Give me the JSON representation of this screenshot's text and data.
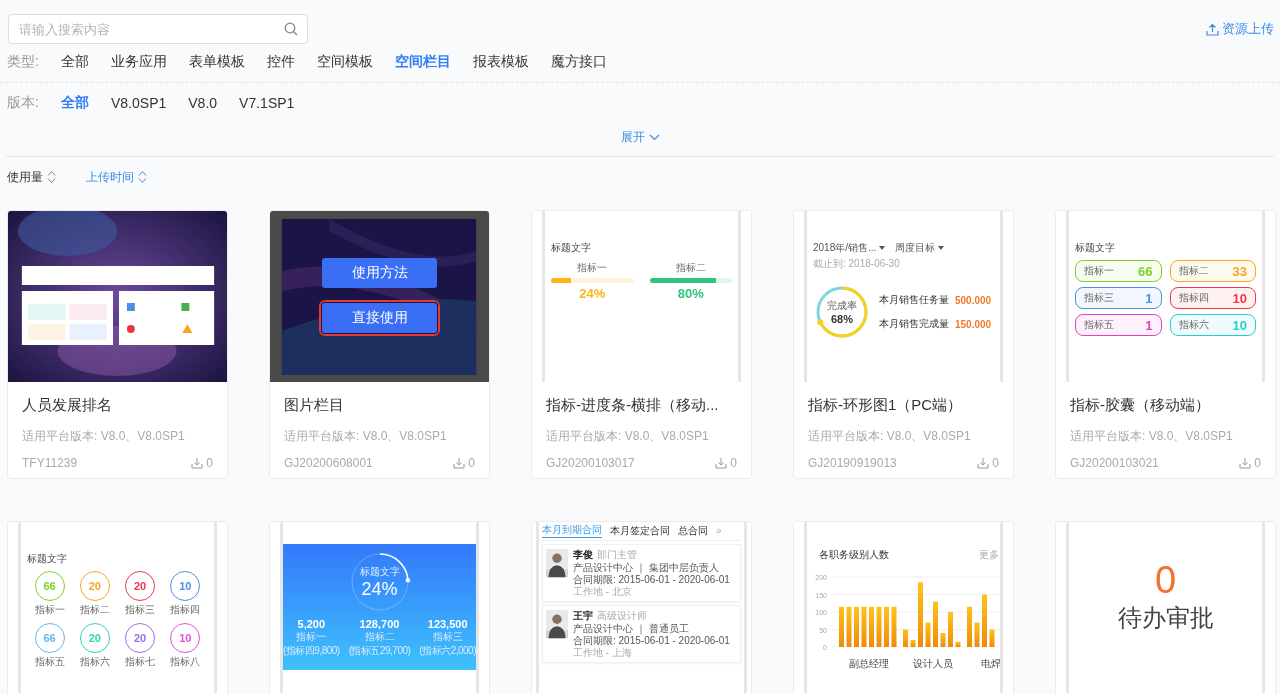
{
  "search": {
    "placeholder": "请输入搜索内容"
  },
  "upload_link": "资源上传",
  "filters": [
    {
      "label": "类型:",
      "options": [
        {
          "text": "全部",
          "selected": false
        },
        {
          "text": "业务应用",
          "selected": false
        },
        {
          "text": "表单模板",
          "selected": false
        },
        {
          "text": "控件",
          "selected": false
        },
        {
          "text": "空间模板",
          "selected": false
        },
        {
          "text": "空间栏目",
          "selected": true
        },
        {
          "text": "报表模板",
          "selected": false
        },
        {
          "text": "魔方接口",
          "selected": false
        }
      ]
    },
    {
      "label": "版本:",
      "options": [
        {
          "text": "全部",
          "selected": true
        },
        {
          "text": "V8.0SP1",
          "selected": false
        },
        {
          "text": "V8.0",
          "selected": false
        },
        {
          "text": "V7.1SP1",
          "selected": false
        }
      ]
    }
  ],
  "expand": {
    "label": "展开",
    "expanded": false
  },
  "sort": [
    {
      "label": "使用量",
      "selected": false
    },
    {
      "label": "上传时间",
      "selected": true
    }
  ],
  "cards": [
    {
      "title": "人员发展排名",
      "platform": "适用平台版本: V8.0、V8.0SP1",
      "code": "TFY11239",
      "downloads": "0"
    },
    {
      "title": "图片栏目",
      "platform": "适用平台版本: V8.0、V8.0SP1",
      "code": "GJ20200608001",
      "downloads": "0",
      "preview": {
        "kind": "buttons",
        "buttons": [
          {
            "text": "使用方法",
            "focused": false
          },
          {
            "text": "直接使用",
            "focused": true
          }
        ]
      }
    },
    {
      "title": "指标-进度条-横排（移动...",
      "platform": "适用平台版本: V8.0、V8.0SP1",
      "code": "GJ20200103017",
      "downloads": "0",
      "preview": {
        "kind": "progress",
        "heading": "标题文字",
        "items": [
          {
            "label": "指标一",
            "level": 0.24,
            "value": "24%",
            "color": "#fbb41a"
          },
          {
            "label": "指标二",
            "level": 0.8,
            "value": "80%",
            "color": "#2fc57c"
          }
        ]
      }
    },
    {
      "title": "指标-环形图1（PC端）",
      "platform": "适用平台版本: V8.0、V8.0SP1",
      "code": "GJ20190919013",
      "downloads": "0",
      "preview": {
        "kind": "ring",
        "selects": [
          "2018年/销售...",
          "周度目标"
        ],
        "date": "截止到: 2018-06-30",
        "ring_label": "完成率",
        "ring_value": "68%",
        "rows": [
          {
            "label": "本月销售任务量",
            "value": "500.000"
          },
          {
            "label": "本月销售完成量",
            "value": "150.000"
          }
        ]
      }
    },
    {
      "title": "指标-胶囊（移动端）",
      "platform": "适用平台版本: V8.0、V8.0SP1",
      "code": "GJ20200103021",
      "downloads": "0",
      "preview": {
        "kind": "capsules",
        "heading": "标题文字",
        "items": [
          {
            "label": "指标一",
            "value": "66",
            "color": "#7ed321"
          },
          {
            "label": "指标二",
            "value": "33",
            "color": "#f5a623"
          },
          {
            "label": "指标三",
            "value": "1",
            "color": "#4a90e2"
          },
          {
            "label": "指标四",
            "value": "10",
            "color": "#f0364b"
          },
          {
            "label": "指标五",
            "value": "1",
            "color": "#e83fc0"
          },
          {
            "label": "指标六",
            "value": "10",
            "color": "#25cfd0"
          }
        ]
      }
    },
    {
      "preview": {
        "kind": "circles",
        "heading": "标题文字",
        "items": [
          {
            "label": "指标一",
            "value": "66",
            "color": "#7ed321"
          },
          {
            "label": "指标二",
            "value": "20",
            "color": "#f5a623"
          },
          {
            "label": "指标三",
            "value": "20",
            "color": "#f0364b"
          },
          {
            "label": "指标四",
            "value": "10",
            "color": "#4a90e2"
          },
          {
            "label": "指标五",
            "value": "66",
            "color": "#5bb8f0"
          },
          {
            "label": "指标六",
            "value": "20",
            "color": "#2fd6b0"
          },
          {
            "label": "指标七",
            "value": "20",
            "color": "#9b6cf0"
          },
          {
            "label": "指标八",
            "value": "10",
            "color": "#e84fd8"
          }
        ]
      }
    },
    {
      "preview": {
        "kind": "gauge",
        "heading": "标题文字",
        "value": "24%",
        "stats": [
          {
            "value": "5,200",
            "label": "指标一",
            "note": "(指标四9,800)"
          },
          {
            "value": "128,700",
            "label": "指标二",
            "note": "(指标五29,700)"
          },
          {
            "value": "123,500",
            "label": "指标三",
            "note": "(指标六2,000)"
          }
        ]
      }
    },
    {
      "preview": {
        "kind": "people",
        "tabs": [
          {
            "text": "本月到期合同",
            "selected": true
          },
          {
            "text": "本月签定合同",
            "selected": false
          },
          {
            "text": "总合同",
            "selected": false
          }
        ],
        "more": "»",
        "people": [
          {
            "name": "李俊",
            "role": "部门主管",
            "dept": "产品设计中心 ｜ 集团中层负责人",
            "term": "合同期限: 2015-06-01 - 2020-06-01",
            "place": "工作地 - 北京"
          },
          {
            "name": "王宇",
            "role": "高级设计师",
            "dept": "产品设计中心 ｜ 普通员工",
            "term": "合同期限: 2015-06-01 - 2020-06-01",
            "place": "工作地 - 上海"
          }
        ]
      }
    },
    {
      "preview": {
        "kind": "bars",
        "more": "更多",
        "chart_data": {
          "type": "bar",
          "title": "各职务级别人数",
          "categories": [
            "副总经理",
            "设计人员",
            "电焊"
          ],
          "ylim": [
            0,
            200
          ],
          "grid": true,
          "yticks": [
            0,
            50,
            100,
            150,
            200
          ],
          "series": [
            {
              "values": [
                115,
                50,
                115
              ]
            },
            {
              "values": [
                115,
                20,
                70
              ]
            },
            {
              "values": [
                115,
                185,
                150
              ]
            },
            {
              "values": [
                115,
                70,
                50
              ]
            },
            {
              "values": [
                115,
                130,
                null
              ]
            },
            {
              "values": [
                115,
                40,
                null
              ]
            },
            {
              "values": [
                115,
                100,
                null
              ]
            },
            {
              "values": [
                115,
                15,
                null
              ]
            }
          ]
        }
      }
    },
    {
      "preview": {
        "kind": "counter",
        "value": "0",
        "label": "待办审批"
      }
    }
  ]
}
